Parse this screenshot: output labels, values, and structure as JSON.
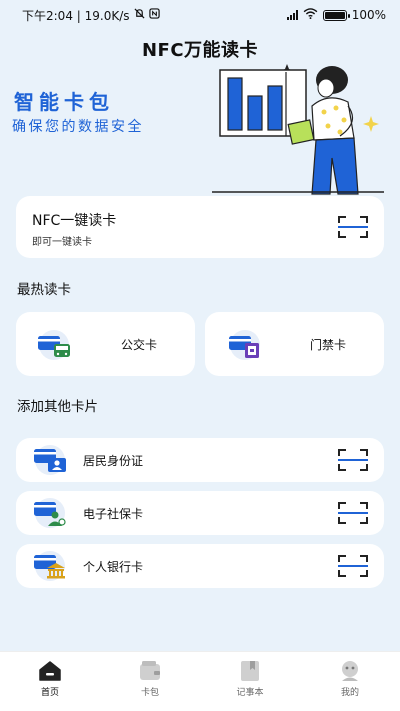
{
  "status_bar": {
    "left_text": "下午2:04 | 19.0K/s",
    "battery_text": "100%"
  },
  "app": {
    "title": "NFC万能读卡"
  },
  "banner": {
    "title": "智能卡包",
    "subtitle": "确保您的数据安全"
  },
  "nfc_card": {
    "title": "NFC一键读卡",
    "subtitle": "即可一键读卡"
  },
  "hot_section": {
    "heading": "最热读卡",
    "items": [
      {
        "label": "公交卡",
        "icon": "bus-card-icon"
      },
      {
        "label": "门禁卡",
        "icon": "access-card-icon"
      }
    ]
  },
  "other_section": {
    "heading": "添加其他卡片",
    "items": [
      {
        "label": "居民身份证",
        "icon": "id-card-icon"
      },
      {
        "label": "电子社保卡",
        "icon": "social-security-card-icon"
      },
      {
        "label": "个人银行卡",
        "icon": "bank-card-icon"
      }
    ]
  },
  "tab_bar": {
    "active": "首页",
    "items": [
      {
        "label": "首页",
        "icon": "home-icon"
      },
      {
        "label": "卡包",
        "icon": "wallet-icon"
      },
      {
        "label": "记事本",
        "icon": "notebook-icon"
      },
      {
        "label": "我的",
        "icon": "profile-icon"
      }
    ]
  },
  "colors": {
    "accent": "#1f63d6",
    "background": "#e9f2fa",
    "card": "#ffffff"
  }
}
